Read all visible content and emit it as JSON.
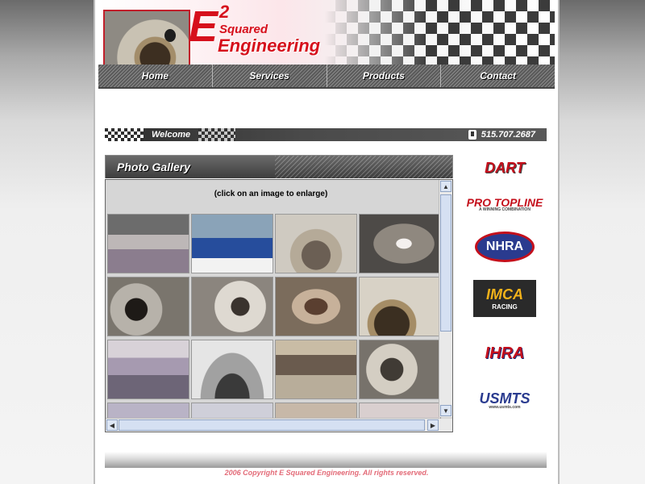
{
  "site": {
    "logo": {
      "e": "E",
      "superscript": "2",
      "squared": "Squared",
      "engineering": "Engineering"
    }
  },
  "nav": {
    "items": [
      {
        "label": "Home"
      },
      {
        "label": "Services"
      },
      {
        "label": "Products"
      },
      {
        "label": "Contact"
      }
    ]
  },
  "welcome": {
    "label": "Welcome",
    "phone": "515.707.2687"
  },
  "gallery": {
    "title": "Photo Gallery",
    "note": "(click on an image to enlarge)"
  },
  "sponsors": {
    "dart": "DART",
    "pro_topline": "PRO TOPLINE",
    "pro_topline_tagline": "A WINNING COMBINATION",
    "nhra": "NHRA",
    "imca": "IMCA",
    "imca_sub": "RACING",
    "ihra": "IHRA",
    "usmts": "USMTS",
    "usmts_url": "www.usmts.com"
  },
  "footer": {
    "copyright": "2006 Copyright E Squared Engineering.  All rights reserved."
  },
  "icons": {
    "phone": "phone-icon",
    "scroll_up": "chevron-up-icon",
    "scroll_down": "chevron-down-icon",
    "scroll_left": "chevron-left-icon",
    "scroll_right": "chevron-right-icon"
  },
  "colors": {
    "brand_red": "#d6101c",
    "nav_dark": "#5a5a5a",
    "footer_text": "#e36b78"
  }
}
